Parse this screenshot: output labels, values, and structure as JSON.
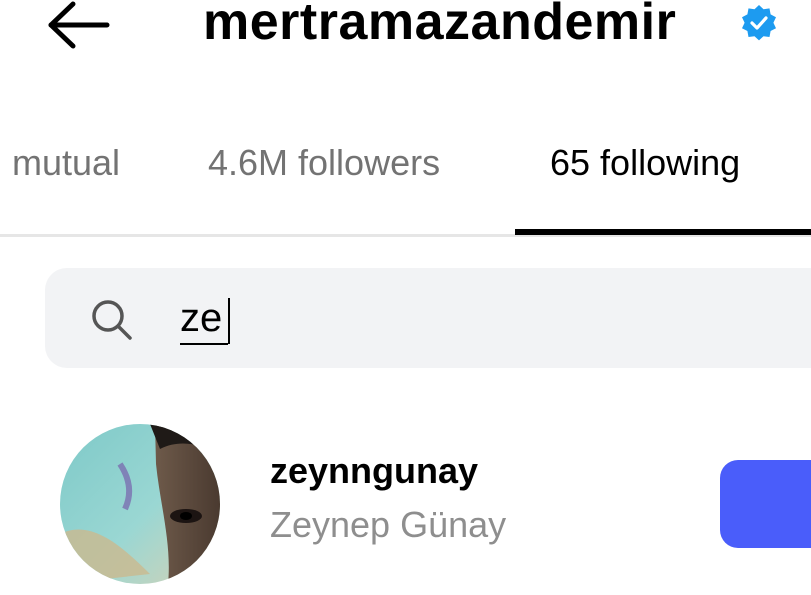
{
  "header": {
    "username": "mertramazandemir",
    "back_icon": "arrow-left-icon",
    "verified_icon": "verified-badge-icon",
    "verified_color": "#1d9bf0"
  },
  "tabs": [
    {
      "label": "mutual",
      "active": false
    },
    {
      "label": "4.6M followers",
      "active": false
    },
    {
      "label": "65 following",
      "active": true
    }
  ],
  "search": {
    "icon": "search-icon",
    "value": "ze"
  },
  "results": [
    {
      "username": "zeynngunay",
      "full_name": "Zeynep Günay",
      "button_color": "#4a5dfa"
    }
  ]
}
